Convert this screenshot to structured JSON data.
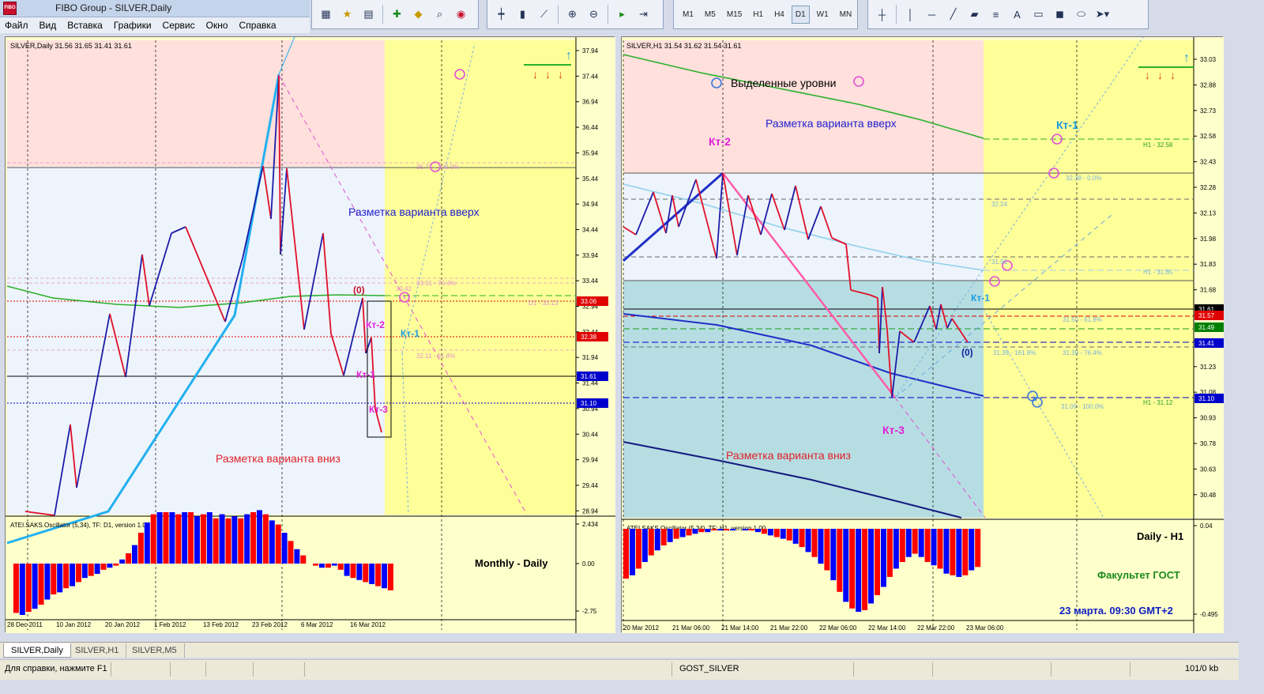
{
  "window": {
    "title": "FIBO Group - SILVER,Daily",
    "icon": "fibo-logo-icon",
    "icon_text": "FIBO"
  },
  "menu": [
    "Файл",
    "Вид",
    "Вставка",
    "Графики",
    "Сервис",
    "Окно",
    "Справка"
  ],
  "toolbars": {
    "timeframes": [
      "M1",
      "M5",
      "M15",
      "H1",
      "H4",
      "D1",
      "W1",
      "MN"
    ],
    "active_timeframe": "D1"
  },
  "left_chart": {
    "header": "SILVER,Daily  31.56 31.65 31.41 31.61",
    "price_labels": [
      "37.94",
      "37.44",
      "36.94",
      "36.44",
      "35.94",
      "35.44",
      "34.94",
      "34.44",
      "33.94",
      "33.44",
      "32.94",
      "32.44",
      "31.94",
      "31.44",
      "30.94",
      "30.44",
      "29.94",
      "29.44",
      "28.94"
    ],
    "price_tags": [
      {
        "text": "33.06",
        "color": "#e00000"
      },
      {
        "text": "32.38",
        "color": "#e00000"
      },
      {
        "text": "31.61",
        "color": "#0000cc"
      },
      {
        "text": "31.10",
        "color": "#0000cc"
      }
    ],
    "labels": {
      "zero": "(0)",
      "kt2": "Кт-2",
      "kt1_blue": "Кт-1",
      "kt1": "Кт-1",
      "kt3": "Кт-3",
      "up": "Разметка варианта вверх",
      "down": "Разметка варианта вниз"
    },
    "fib_labels": [
      "35.71 - 100.0%",
      "33.51 - 76.4%",
      "33.42",
      "32.11 - 61.8%",
      "D1 - 33.13"
    ],
    "oscillator": {
      "header": "ATEI.SAKS.Oscillator (5,34), TF: D1, version 1.00",
      "scale": [
        "2.434",
        "0.00",
        "-2.75"
      ],
      "caption": "Monthly - Daily"
    },
    "dates": [
      "28 Dec 2011",
      "10 Jan 2012",
      "20 Jan 2012",
      "1 Feb 2012",
      "13 Feb 2012",
      "23 Feb 2012",
      "6 Mar 2012",
      "16 Mar 2012"
    ]
  },
  "right_chart": {
    "header": "SILVER,H1  31.54 31.62 31.54 31.61",
    "price_labels": [
      "33.03",
      "32.88",
      "32.73",
      "32.58",
      "32.43",
      "32.28",
      "32.13",
      "31.98",
      "31.83",
      "31.68",
      "31.53",
      "31.38",
      "31.23",
      "31.08",
      "30.93",
      "30.78",
      "30.63",
      "30.48"
    ],
    "price_tags": [
      {
        "text": "31.61",
        "color": "#000000"
      },
      {
        "text": "31.57",
        "color": "#e00000"
      },
      {
        "text": "31.49",
        "color": "#008000"
      },
      {
        "text": "31.41",
        "color": "#0000cc"
      },
      {
        "text": "31.10",
        "color": "#0000cc"
      }
    ],
    "labels": {
      "legend": "Выделенные уровни",
      "up": "Разметка варианта вверх",
      "down": "Разметка варианта вниз",
      "kt2": "Кт-2",
      "kt1": "Кт-1",
      "kt1_blue": "Кт-1",
      "kt3": "Кт-3",
      "zero": "(0)"
    },
    "fib_labels": [
      "H1 - 32.58",
      "32.38 - 0.0%",
      "32.24",
      "31.91",
      "H1 - 31.85",
      "31.50 - 61.8%",
      "31.39 - 161.8%",
      "31.39 - 76.4%",
      "31.09 - 100.0%",
      "H1 - 31.12"
    ],
    "oscillator": {
      "header": "ATEI.SAKS.Oscillator (5,34), TF: H1, version 1.00",
      "scale": [
        "0.04",
        "-0.495"
      ],
      "captions": {
        "tf": "Daily - H1",
        "faculty": "Факультет ГОСТ",
        "date": "23 марта. 09:30 GMT+2"
      }
    },
    "dates": [
      "20 Mar 2012",
      "21 Mar 06:00",
      "21 Mar 14:00",
      "21 Mar 22:00",
      "22 Mar 06:00",
      "22 Mar 14:00",
      "22 Mar 22:00",
      "23 Mar 06:00"
    ]
  },
  "tabs": [
    "SILVER,Daily",
    "SILVER,H1",
    "SILVER,M5"
  ],
  "active_tab": 0,
  "status": {
    "help": "Для справки, нажмите F1",
    "profile": "GOST_SILVER",
    "traffic": "101/0 kb"
  }
}
